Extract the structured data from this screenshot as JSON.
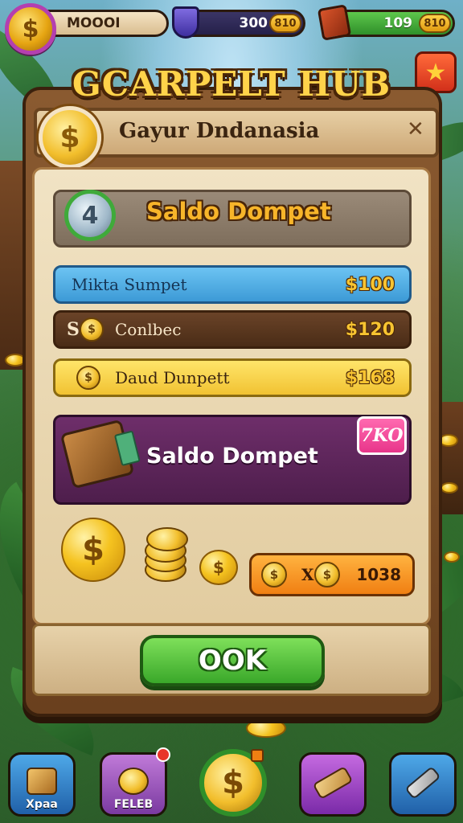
{
  "topbar": {
    "resource1": {
      "value": "MOOOI"
    },
    "resource2": {
      "value": "300",
      "badge": "810"
    },
    "resource3": {
      "value": "109",
      "badge": "810"
    }
  },
  "hub_title": "GCARPELT HUB",
  "header": {
    "title": "Gayur Dndanasia"
  },
  "balance": {
    "title": "Saldo Dompet",
    "icon_glyph": "4"
  },
  "rows": [
    {
      "label": "Mikta Sumpet",
      "amount": "$100"
    },
    {
      "prefix": "S",
      "label": "Conlbec",
      "amount": "$120"
    },
    {
      "label": "Daud Dunpett",
      "amount": "$168"
    }
  ],
  "wallet": {
    "title": "Saldo Dompet",
    "badge": "7KO"
  },
  "exchange": {
    "middle": "X",
    "amount": "1038"
  },
  "ok_button": {
    "label": "OOK"
  },
  "nav": [
    {
      "label": "Xpaa",
      "icon": "box-icon"
    },
    {
      "label": "FELEB",
      "icon": "coin-jar-icon"
    },
    {
      "label": "",
      "icon": "dollar-coin-icon"
    },
    {
      "label": "",
      "icon": "scroll-potion-icon"
    },
    {
      "label": "",
      "icon": "hammer-icon"
    }
  ],
  "colors": {
    "panel_wood": "#7a4a24",
    "ok_green": "#3aa82a",
    "gold": "#f7c431",
    "wallet_purple": "#6e2e6a",
    "row_blue": "#3c9ad6",
    "row_yellow": "#f1c232"
  }
}
